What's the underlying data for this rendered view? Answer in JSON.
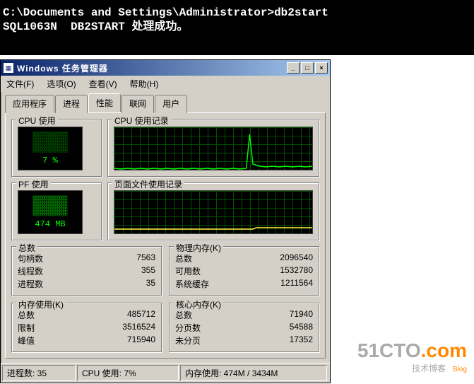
{
  "console": {
    "line1": "C:\\Documents and Settings\\Administrator>db2start",
    "line2": "SQL1063N  DB2START 处理成功。"
  },
  "taskmgr": {
    "title": "Windows 任务管理器",
    "menu": {
      "file": "文件(F)",
      "options": "选项(O)",
      "view": "查看(V)",
      "help": "帮助(H)"
    },
    "tabs": {
      "apps": "应用程序",
      "procs": "进程",
      "perf": "性能",
      "net": "联网",
      "users": "用户"
    },
    "groups": {
      "cpu_usage": "CPU 使用",
      "cpu_history": "CPU 使用记录",
      "pf_usage": "PF 使用",
      "pf_history": "页面文件使用记录",
      "totals": "总数",
      "phys_mem": "物理内存(K)",
      "commit": "内存使用(K)",
      "kernel": "核心内存(K)"
    },
    "meters": {
      "cpu_value": "7 %",
      "pf_value": "474 MB"
    },
    "totals": {
      "handles_label": "句柄数",
      "handles": "7563",
      "threads_label": "线程数",
      "threads": "355",
      "procs_label": "进程数",
      "procs": "35"
    },
    "phys_mem": {
      "total_label": "总数",
      "total": "2096540",
      "avail_label": "可用数",
      "avail": "1532780",
      "cache_label": "系统缓存",
      "cache": "1211564"
    },
    "commit": {
      "total_label": "总数",
      "total": "485712",
      "limit_label": "限制",
      "limit": "3516524",
      "peak_label": "峰值",
      "peak": "715940"
    },
    "kernel": {
      "total_label": "总数",
      "total": "71940",
      "paged_label": "分页数",
      "paged": "54588",
      "nonpaged_label": "未分页",
      "nonpaged": "17352"
    },
    "statusbar": {
      "procs": "进程数: 35",
      "cpu": "CPU 使用: 7%",
      "mem": "内存使用: 474M / 3434M"
    }
  },
  "brand": {
    "main": "51CTO",
    "suffix": ".com",
    "sub": "技术博客",
    "tag": "Blog"
  },
  "chart_data": [
    {
      "type": "line",
      "title": "CPU 使用记录",
      "xlabel": "",
      "ylabel": "",
      "ylim": [
        0,
        100
      ],
      "series": [
        {
          "name": "CPU",
          "values": [
            3,
            2,
            3,
            2,
            3,
            2,
            3,
            2,
            3,
            2,
            3,
            2,
            3,
            2,
            3,
            2,
            3,
            2,
            3,
            2,
            3,
            2,
            3,
            2,
            3,
            2,
            3,
            2,
            3,
            2,
            3,
            85,
            12,
            8,
            6,
            7,
            6,
            7,
            6,
            7,
            6,
            7,
            6,
            7,
            6,
            7
          ]
        }
      ]
    },
    {
      "type": "line",
      "title": "页面文件使用记录",
      "xlabel": "",
      "ylabel": "",
      "ylim": [
        0,
        100
      ],
      "series": [
        {
          "name": "PF",
          "values": [
            9,
            9,
            9,
            9,
            9,
            9,
            9,
            9,
            9,
            9,
            9,
            9,
            9,
            9,
            9,
            9,
            9,
            9,
            9,
            9,
            9,
            9,
            9,
            9,
            9,
            9,
            9,
            9,
            9,
            9,
            9,
            9,
            13,
            13,
            13,
            13,
            13,
            13,
            13,
            13,
            13,
            13,
            13,
            13,
            13,
            13
          ]
        }
      ]
    }
  ]
}
